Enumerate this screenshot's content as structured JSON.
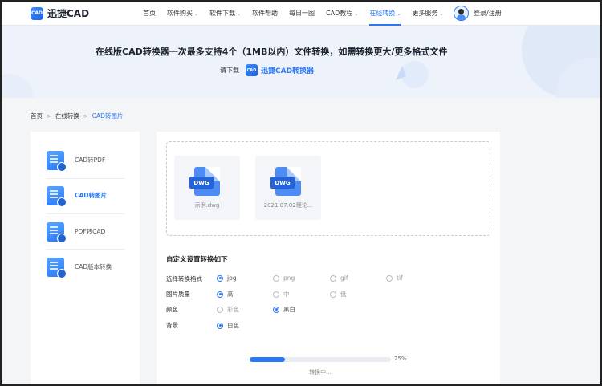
{
  "header": {
    "logo_icon_text": "CAD",
    "logo_text": "迅捷CAD",
    "nav": [
      {
        "label": "首页",
        "dropdown": false
      },
      {
        "label": "软件购买",
        "dropdown": true
      },
      {
        "label": "软件下载",
        "dropdown": true
      },
      {
        "label": "软件帮助",
        "dropdown": false
      },
      {
        "label": "每日一图",
        "dropdown": false
      },
      {
        "label": "CAD教程",
        "dropdown": true
      },
      {
        "label": "在线转换",
        "dropdown": true,
        "active": true
      },
      {
        "label": "更多服务",
        "dropdown": true
      }
    ],
    "login_label": "登录/注册"
  },
  "banner": {
    "title": "在线版CAD转换器一次最多支持4个（1MB以内）文件转换，如需转换更大/更多格式文件",
    "download_prefix": "请下载",
    "download_icon_text": "CAD",
    "download_link": "迅捷CAD转换器"
  },
  "breadcrumb": {
    "items": [
      "首页",
      "在线转换",
      "CAD转图片"
    ],
    "separator": ">"
  },
  "sidebar": {
    "items": [
      {
        "label": "CAD转PDF",
        "active": false
      },
      {
        "label": "CAD转图片",
        "active": true
      },
      {
        "label": "PDF转CAD",
        "active": false
      },
      {
        "label": "CAD版本转换",
        "active": false
      }
    ]
  },
  "files": [
    {
      "badge": "DWG",
      "name": "示例.dwg"
    },
    {
      "badge": "DWG",
      "name": "2021.07.02理论..."
    }
  ],
  "settings": {
    "title": "自定义设置转换如下",
    "format": {
      "label": "选择转换格式",
      "options": [
        "jpg",
        "png",
        "gif",
        "tif"
      ],
      "selected": "jpg"
    },
    "quality": {
      "label": "图片质量",
      "options": [
        "高",
        "中",
        "低"
      ],
      "selected": "高"
    },
    "color": {
      "label": "颜色",
      "options": [
        "彩色",
        "黑白"
      ],
      "selected": "黑白"
    },
    "background": {
      "label": "背景",
      "options": [
        "白色"
      ],
      "selected": "白色"
    }
  },
  "progress": {
    "percent": 25,
    "percent_label": "25%",
    "status": "转换中..."
  },
  "colors": {
    "accent": "#2b78f6",
    "page_bg": "#f4f5f7",
    "banner_bg": "#eef3fb"
  }
}
